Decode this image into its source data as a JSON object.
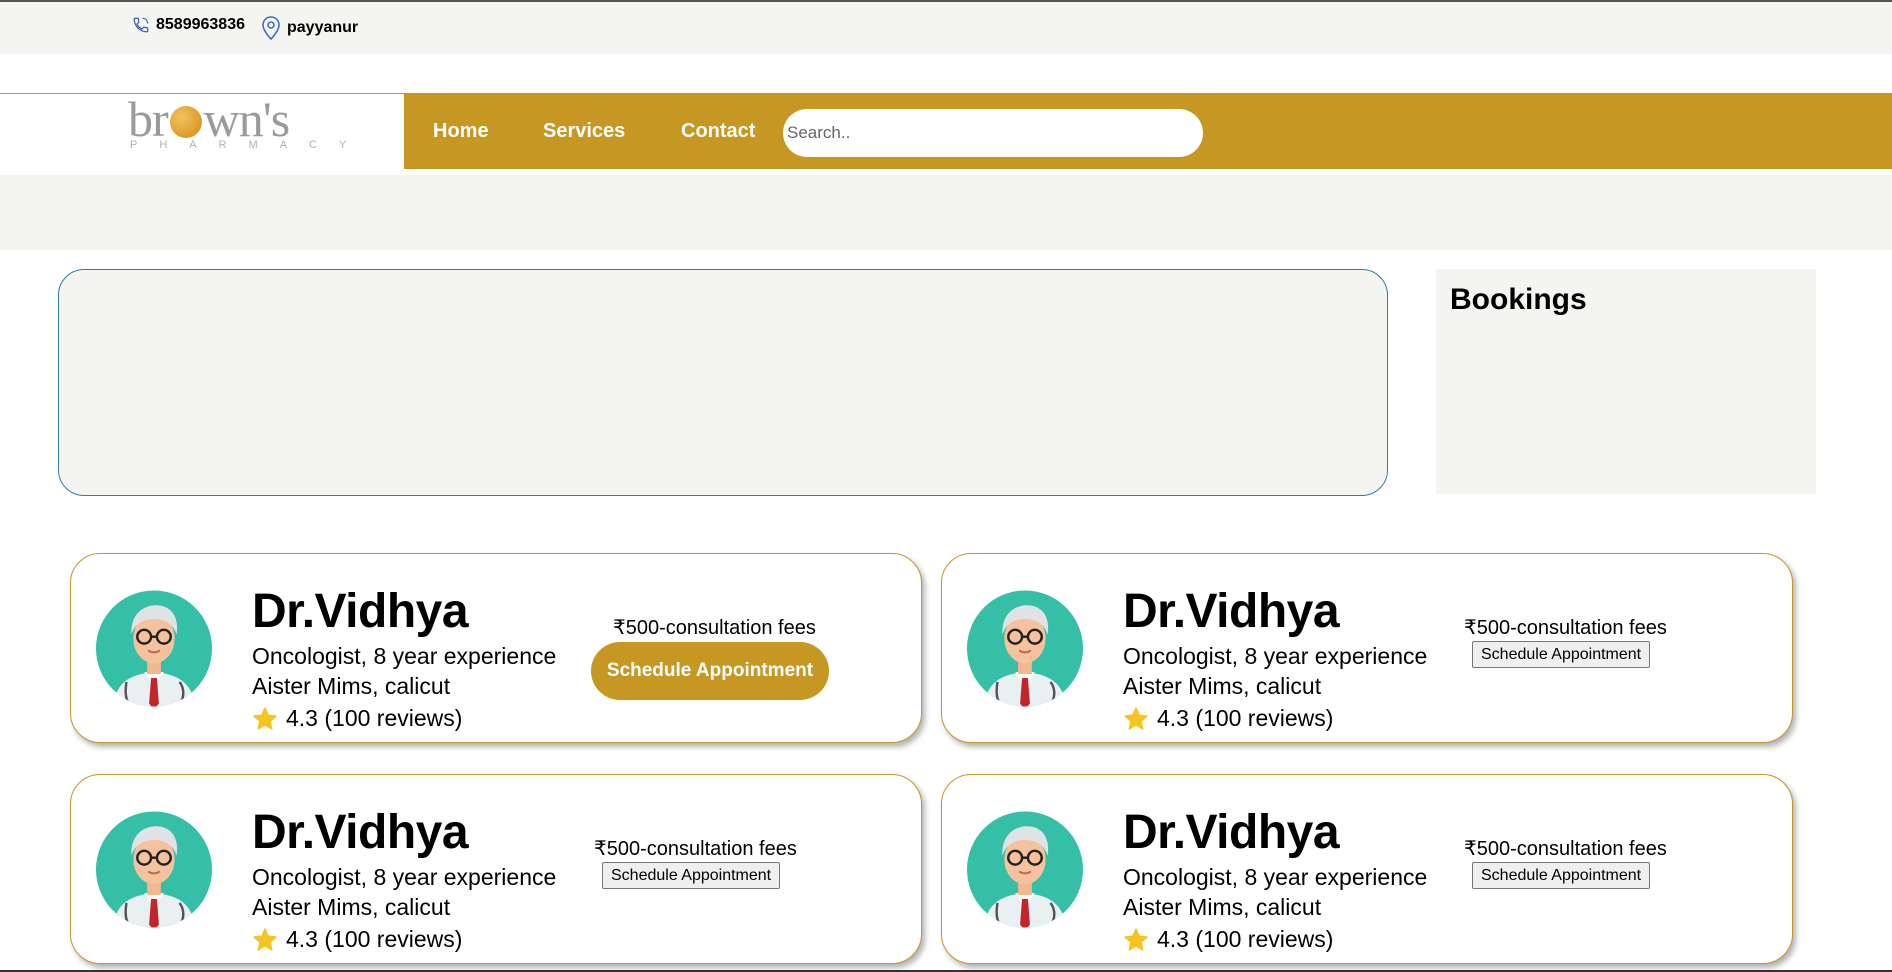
{
  "topbar": {
    "phone": "8589963836",
    "location": "payyanur",
    "phone_icon": "phone-icon",
    "location_icon": "map-pin-icon"
  },
  "logo": {
    "brand_before": "br",
    "brand_after": "wn's",
    "tagline": "PHARMACY"
  },
  "nav": {
    "home": "Home",
    "services": "Services",
    "contact": "Contact",
    "search_placeholder": "Search.."
  },
  "bookings": {
    "title": "Bookings"
  },
  "doctors": [
    {
      "name": "Dr.Vidhya",
      "specialty": "Oncologist, 8 year experience",
      "hospital": "Aister Mims, calicut",
      "rating": "4.3 (100 reviews)",
      "fee": "₹500-consultation fees",
      "button": "Schedule Appointment"
    },
    {
      "name": "Dr.Vidhya",
      "specialty": "Oncologist, 8 year experience",
      "hospital": "Aister Mims, calicut",
      "rating": "4.3 (100 reviews)",
      "fee": "₹500-consultation fees",
      "button": "Schedule Appointment"
    },
    {
      "name": "Dr.Vidhya",
      "specialty": "Oncologist, 8 year experience",
      "hospital": "Aister Mims, calicut",
      "rating": "4.3 (100 reviews)",
      "fee": "₹500-consultation fees",
      "button": "Schedule Appointment"
    },
    {
      "name": "Dr.Vidhya",
      "specialty": "Oncologist, 8 year experience",
      "hospital": "Aister Mims, calicut",
      "rating": "4.3 (100 reviews)",
      "fee": "₹500-consultation fees",
      "button": "Schedule Appointment"
    }
  ],
  "colors": {
    "accent": "#c69723",
    "banner_border": "#2e7ea3",
    "panel_bg": "#f4f4f1",
    "avatar_bg": "#35bfa6"
  }
}
